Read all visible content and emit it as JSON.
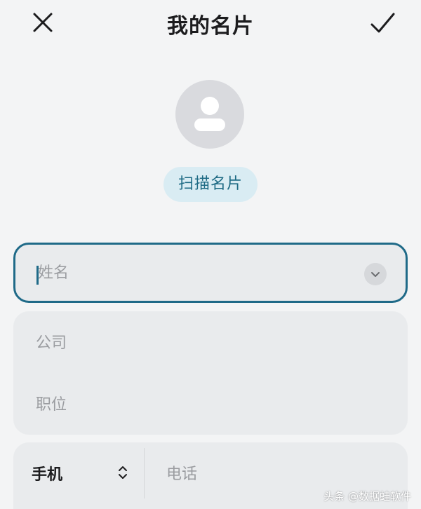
{
  "header": {
    "title": "我的名片",
    "close_icon": "close-icon",
    "confirm_icon": "checkmark-icon"
  },
  "avatar": {
    "icon": "person-icon"
  },
  "scan_button": {
    "label": "扫描名片"
  },
  "form": {
    "name": {
      "placeholder": "姓名",
      "value": "",
      "expand_icon": "chevron-down-icon"
    },
    "company": {
      "placeholder": "公司",
      "value": ""
    },
    "position": {
      "placeholder": "职位",
      "value": ""
    },
    "phone": {
      "type_label": "手机",
      "type_icon": "up-down-chevron-icon",
      "placeholder": "电话",
      "value": ""
    }
  },
  "watermark": {
    "text": "头条 @数据蛙软件"
  },
  "colors": {
    "background": "#f3f4f5",
    "field_background": "#e9ebed",
    "accent": "#1f6a88",
    "scan_button_bg": "#d9ecf3",
    "scan_button_text": "#1d6a84",
    "avatar_bg": "#d9dade"
  }
}
